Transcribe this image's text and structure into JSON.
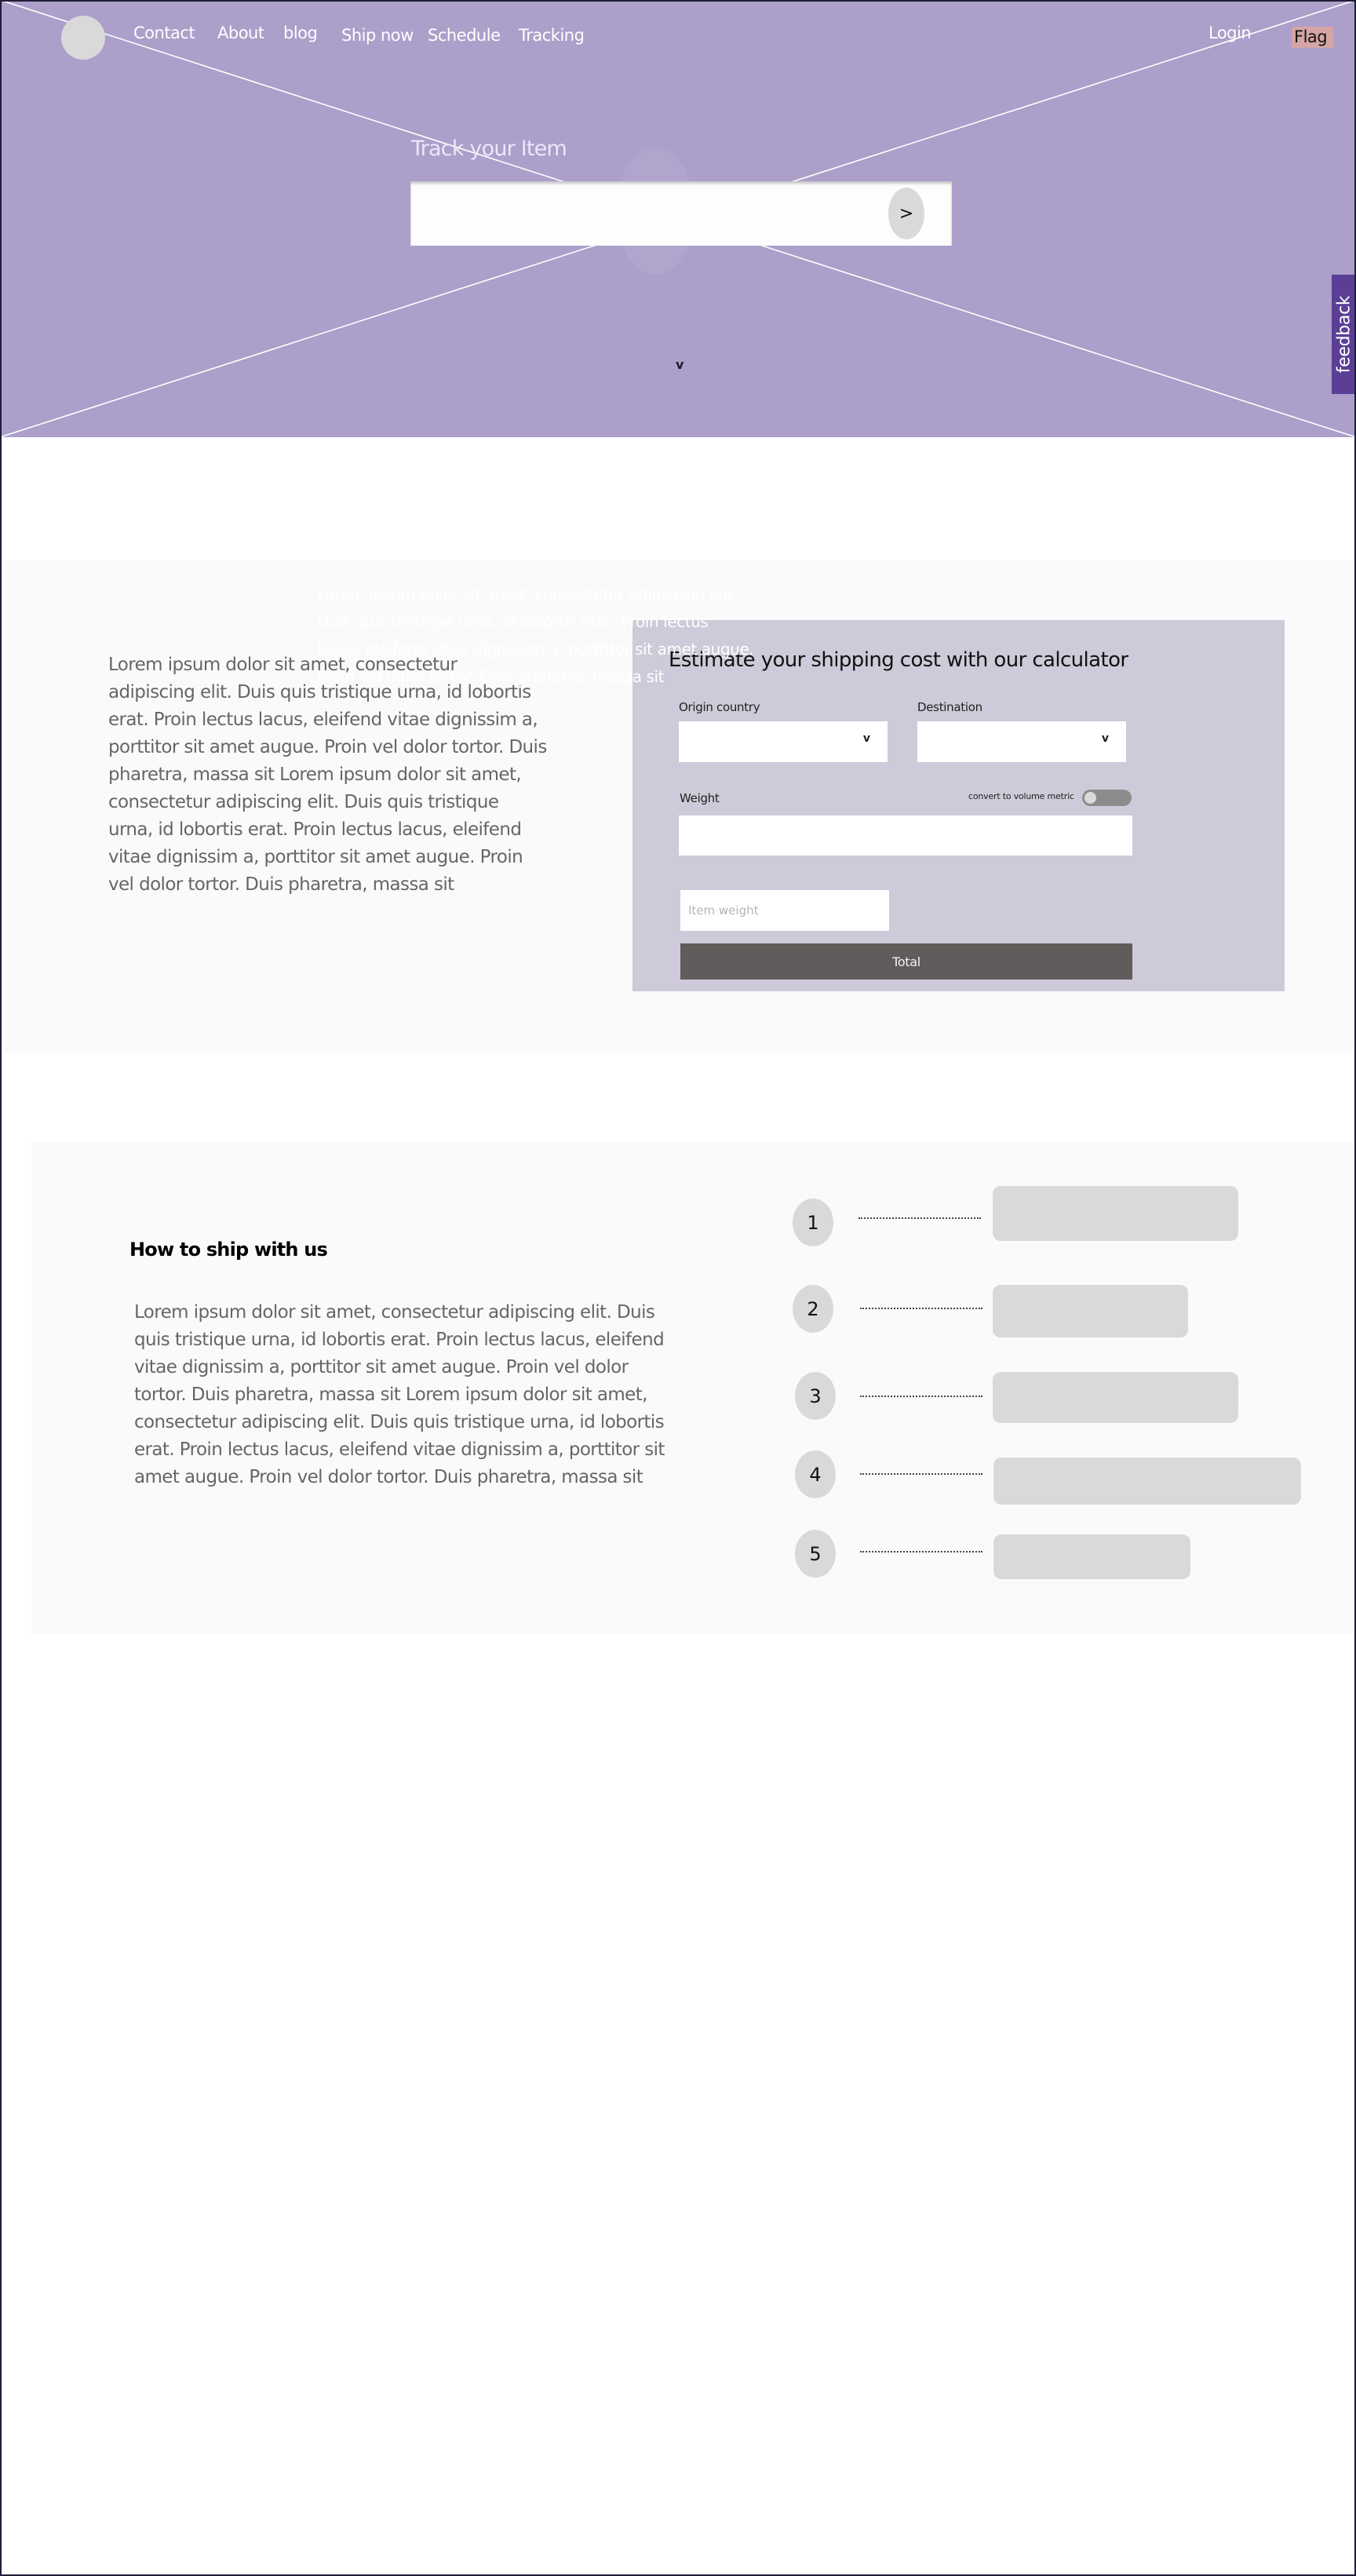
{
  "nav": {
    "logo": "logo",
    "links": [
      "Contact",
      "About",
      "blog",
      "Ship now",
      "Schedule",
      "Tracking"
    ],
    "login": "Login",
    "flag": "Flag"
  },
  "hero": {
    "track_label": "Track your Item",
    "track_input_value": "",
    "track_input_placeholder": "",
    "go_button": ">",
    "scroll_down": "v",
    "feedback": "feedback"
  },
  "intro": {
    "ghost_text": "Lorem ipsum dolor sit amet, consectetur adipiscing elit. Duis quis tristique urna, id lobortis erat. Proin lectus lacus, eleifend vitae dignissim a, porttitor sit amet augue. Proin vel dolor tortor. Duis pharetra, massa sit",
    "text": "Lorem ipsum dolor sit amet, consectetur adipiscing elit. Duis quis tristique urna, id lobortis erat. Proin lectus lacus, eleifend vitae dignissim a, porttitor sit amet augue. Proin vel dolor tortor. Duis pharetra, massa sit Lorem ipsum dolor sit amet, consectetur adipiscing elit. Duis quis tristique urna, id lobortis erat. Proin lectus lacus, eleifend vitae dignissim a, porttitor sit amet augue. Proin vel dolor tortor. Duis pharetra, massa sit"
  },
  "calculator": {
    "title": "Estimate your shipping cost with our calculator",
    "origin_label": "Origin country",
    "origin_value": "",
    "destination_label": "Destination",
    "destination_value": "",
    "select_chevron": "v",
    "weight_label": "Weight",
    "weight_value": "",
    "convert_label": "convert to volume metric",
    "convert_on": false,
    "item_weight_placeholder": "Item weight",
    "item_weight_value": "",
    "total_button": "Total"
  },
  "how_to": {
    "title": "How to ship with us",
    "text": "Lorem ipsum dolor sit amet, consectetur adipiscing elit. Duis quis tristique urna, id lobortis erat. Proin lectus lacus, eleifend vitae dignissim a, porttitor sit amet augue. Proin vel dolor tortor. Duis pharetra, massa sit Lorem ipsum dolor sit amet, consectetur adipiscing elit. Duis quis tristique urna, id lobortis erat. Proin lectus lacus, eleifend vitae dignissim a, porttitor sit amet augue. Proin vel dolor tortor. Duis pharetra, massa sit",
    "steps": [
      "1",
      "2",
      "3",
      "4",
      "5"
    ]
  },
  "colors": {
    "hero_bg": "#AC9FCA",
    "feedback_bg": "#5B3E96",
    "flag_bg": "#D4A5A5",
    "calculator_bg": "#CECAD9",
    "total_button_bg": "#5F5C5B",
    "placeholder_gray": "#D9D9D9",
    "section_bg": "#FAFAFA"
  }
}
